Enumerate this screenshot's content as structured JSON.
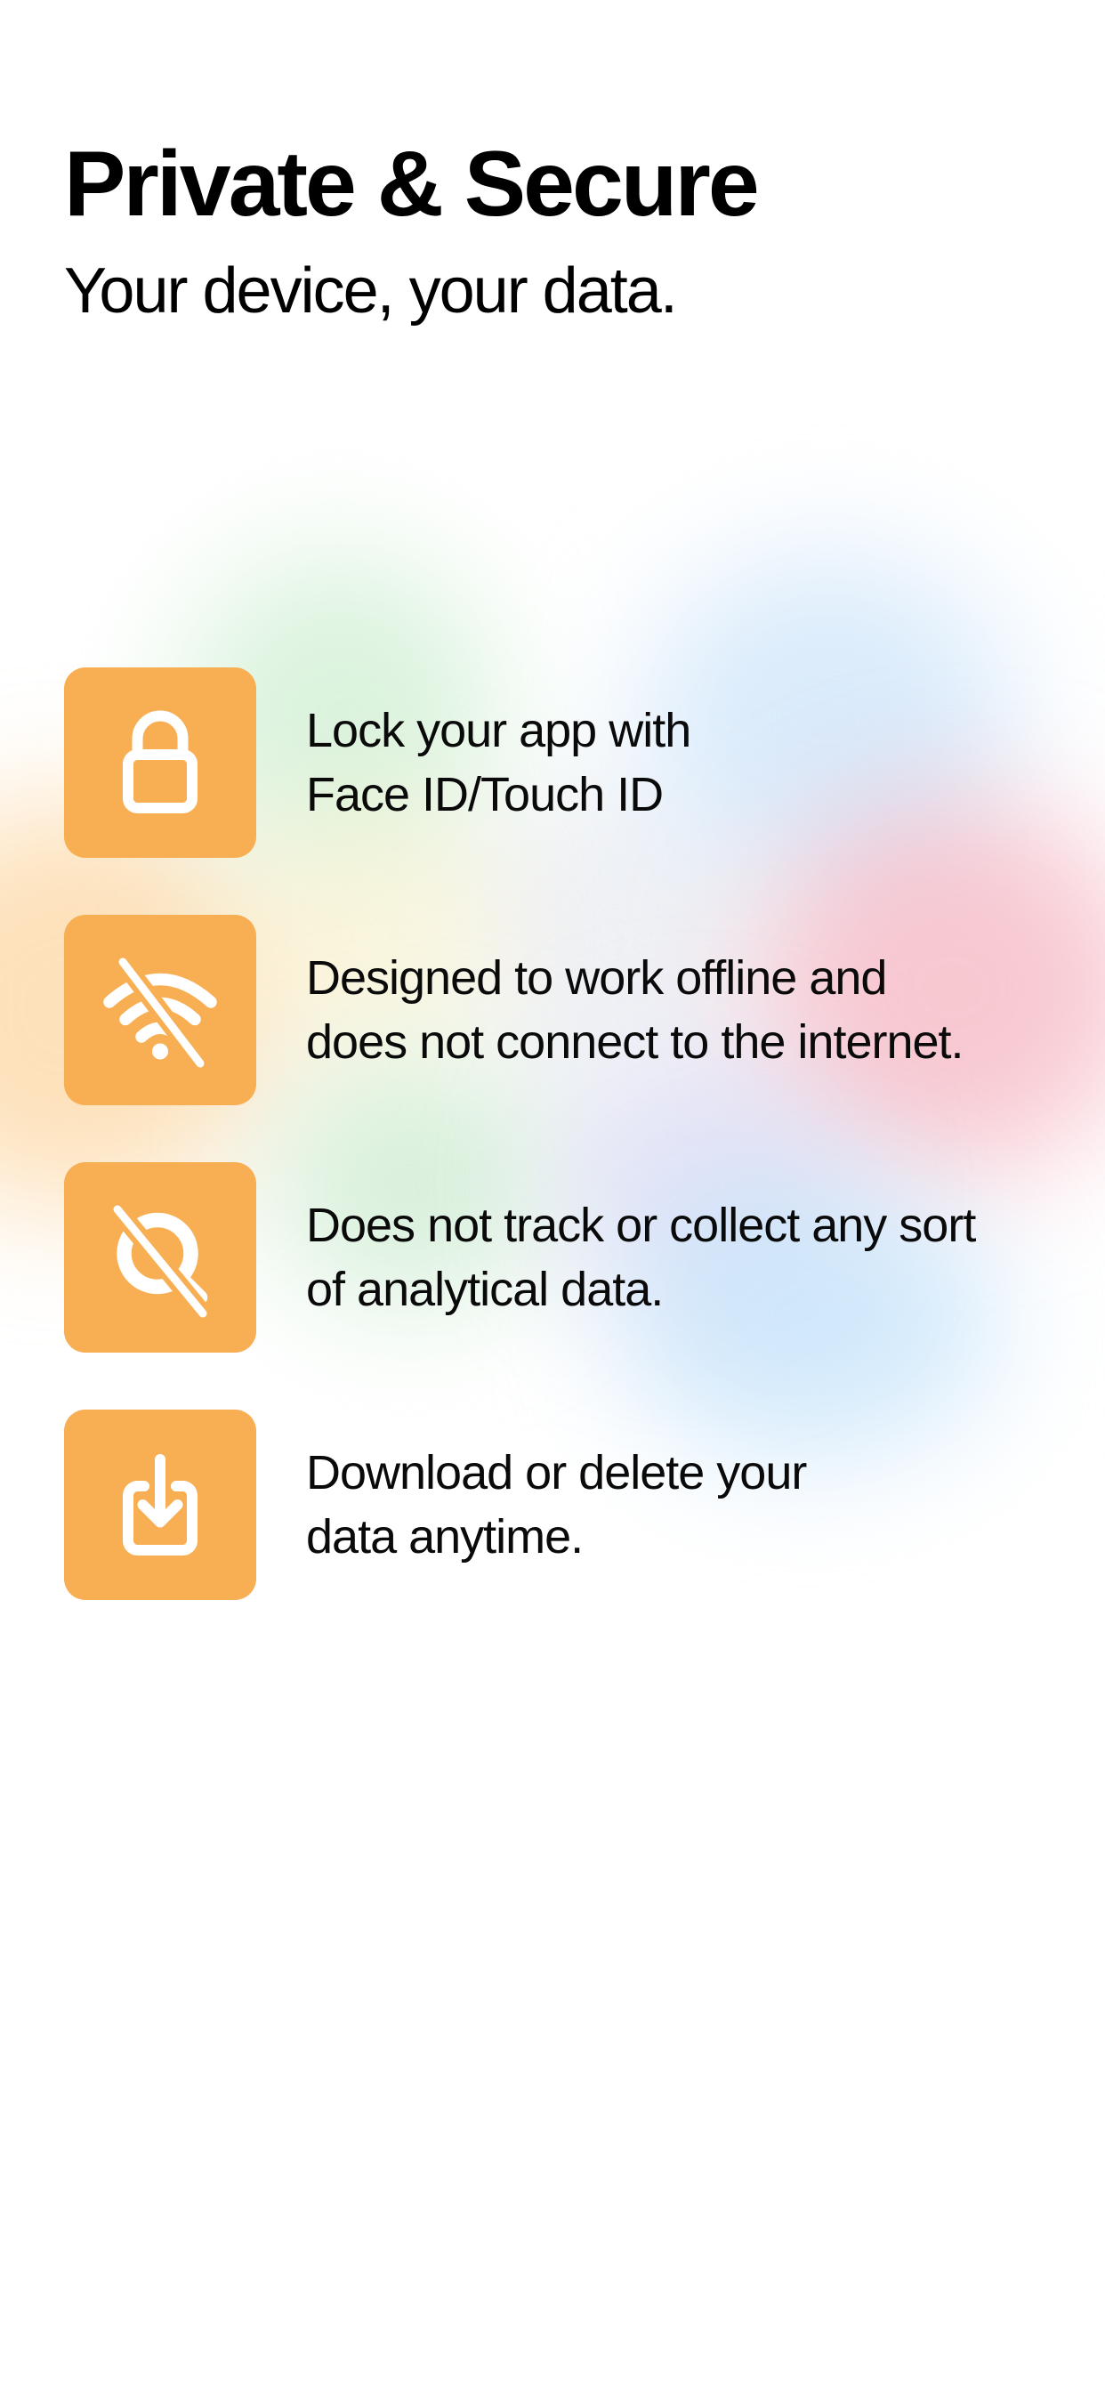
{
  "header": {
    "title": "Private & Secure",
    "subtitle": "Your device, your data."
  },
  "colors": {
    "accent": "#F8AE52",
    "icon": "#FFFFFF",
    "text": "#000000",
    "background": "#FFFFFF"
  },
  "features": [
    {
      "icon": "lock-icon",
      "text": "Lock your app with\nFace ID/Touch ID"
    },
    {
      "icon": "wifi-off-icon",
      "text": "Designed to work offline and\ndoes not connect to the internet."
    },
    {
      "icon": "no-tracking-icon",
      "text": "Does not track or collect any sort\nof analytical data."
    },
    {
      "icon": "download-icon",
      "text": "Download or delete your\ndata anytime."
    }
  ]
}
